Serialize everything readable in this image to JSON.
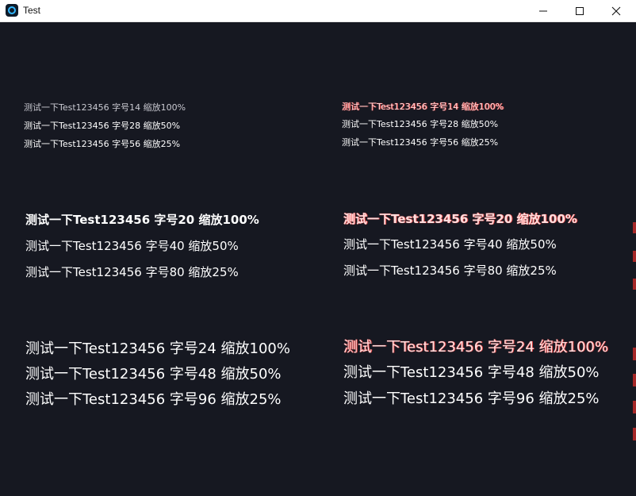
{
  "window": {
    "title": "Test",
    "icon": "app-icon",
    "controls": {
      "minimize_icon": "minimize-icon",
      "maximize_icon": "maximize-icon",
      "close_icon": "close-icon"
    }
  },
  "colors": {
    "background": "#161821",
    "text": "#ffffff",
    "text_dim": "#c9c9d1",
    "text_red_tint": "#ffdede",
    "accent_red": "#a62828"
  },
  "groups": {
    "size14": {
      "left": [
        "测试一下Test123456 字号14 缩放100%",
        "测试一下Test123456 字号28 缩放50%",
        "测试一下Test123456 字号56 缩放25%"
      ],
      "right": [
        "测试一下Test123456 字号14 缩放100%",
        "测试一下Test123456 字号28 缩放50%",
        "测试一下Test123456 字号56 缩放25%"
      ]
    },
    "size20": {
      "left": [
        "测试一下Test123456 字号20 缩放100%",
        "测试一下Test123456 字号40 缩放50%",
        "测试一下Test123456 字号80 缩放25%"
      ],
      "right": [
        "测试一下Test123456 字号20 缩放100%",
        "测试一下Test123456 字号40 缩放50%",
        "测试一下Test123456 字号80 缩放25%"
      ]
    },
    "size24": {
      "left": [
        "测试一下Test123456 字号24 缩放100%",
        "测试一下Test123456 字号48 缩放50%",
        "测试一下Test123456 字号96 缩放25%"
      ],
      "right": [
        "测试一下Test123456 字号24 缩放100%",
        "测试一下Test123456 字号48 缩放50%",
        "测试一下Test123456 字号96 缩放25%"
      ]
    }
  }
}
